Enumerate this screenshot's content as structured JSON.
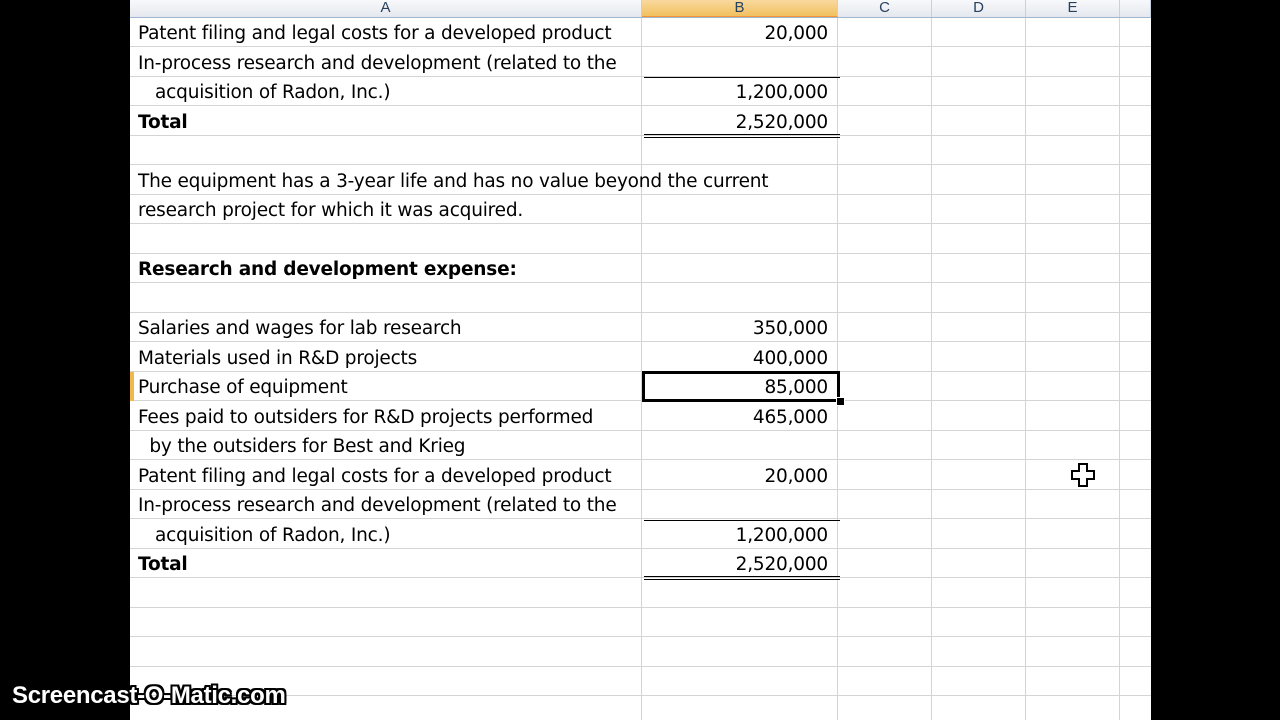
{
  "columns": [
    "A",
    "B",
    "C",
    "D",
    "E"
  ],
  "rows": [
    {
      "a": "Patent filing and legal costs for a developed product",
      "b": "20,000"
    },
    {
      "a": "In-process research and development (related to the",
      "b": ""
    },
    {
      "a": "   acquisition of Radon, Inc.)",
      "b": "1,200,000"
    },
    {
      "a": "Total",
      "b": "2,520,000",
      "bold": true
    },
    {
      "a": "",
      "b": ""
    },
    {
      "a": "The equipment has a 3-year life and has no value beyond the current",
      "b": ""
    },
    {
      "a": "research project for which it was acquired.",
      "b": ""
    },
    {
      "a": "",
      "b": ""
    },
    {
      "a": "Research and development expense:",
      "b": "",
      "bold": true
    },
    {
      "a": "",
      "b": ""
    },
    {
      "a": "Salaries and wages for lab research",
      "b": "350,000"
    },
    {
      "a": "Materials used in R&D projects",
      "b": "400,000"
    },
    {
      "a": "Purchase of equipment",
      "b": "85,000",
      "active": true
    },
    {
      "a": "Fees paid to outsiders for R&D projects performed",
      "b": "465,000"
    },
    {
      "a": "  by the outsiders for Best and Krieg",
      "b": ""
    },
    {
      "a": "Patent filing and legal costs for a developed product",
      "b": "20,000"
    },
    {
      "a": "In-process research and development (related to the",
      "b": ""
    },
    {
      "a": "   acquisition of Radon, Inc.)",
      "b": "1,200,000"
    },
    {
      "a": "Total",
      "b": "2,520,000",
      "bold": true
    },
    {
      "a": "",
      "b": ""
    },
    {
      "a": "",
      "b": ""
    },
    {
      "a": "",
      "b": ""
    },
    {
      "a": "",
      "b": ""
    },
    {
      "a": "",
      "b": ""
    }
  ],
  "selected_column": "B",
  "active_cell": "B13",
  "watermark": "Screencast-O-Matic.com",
  "cursor_icon": "cell-select-cross-cursor-icon",
  "colors": {
    "header_bg": "#e4e8ee",
    "selected_header": "#f1c15f",
    "grid_line": "#d4d4d4",
    "frame": "#000000"
  }
}
